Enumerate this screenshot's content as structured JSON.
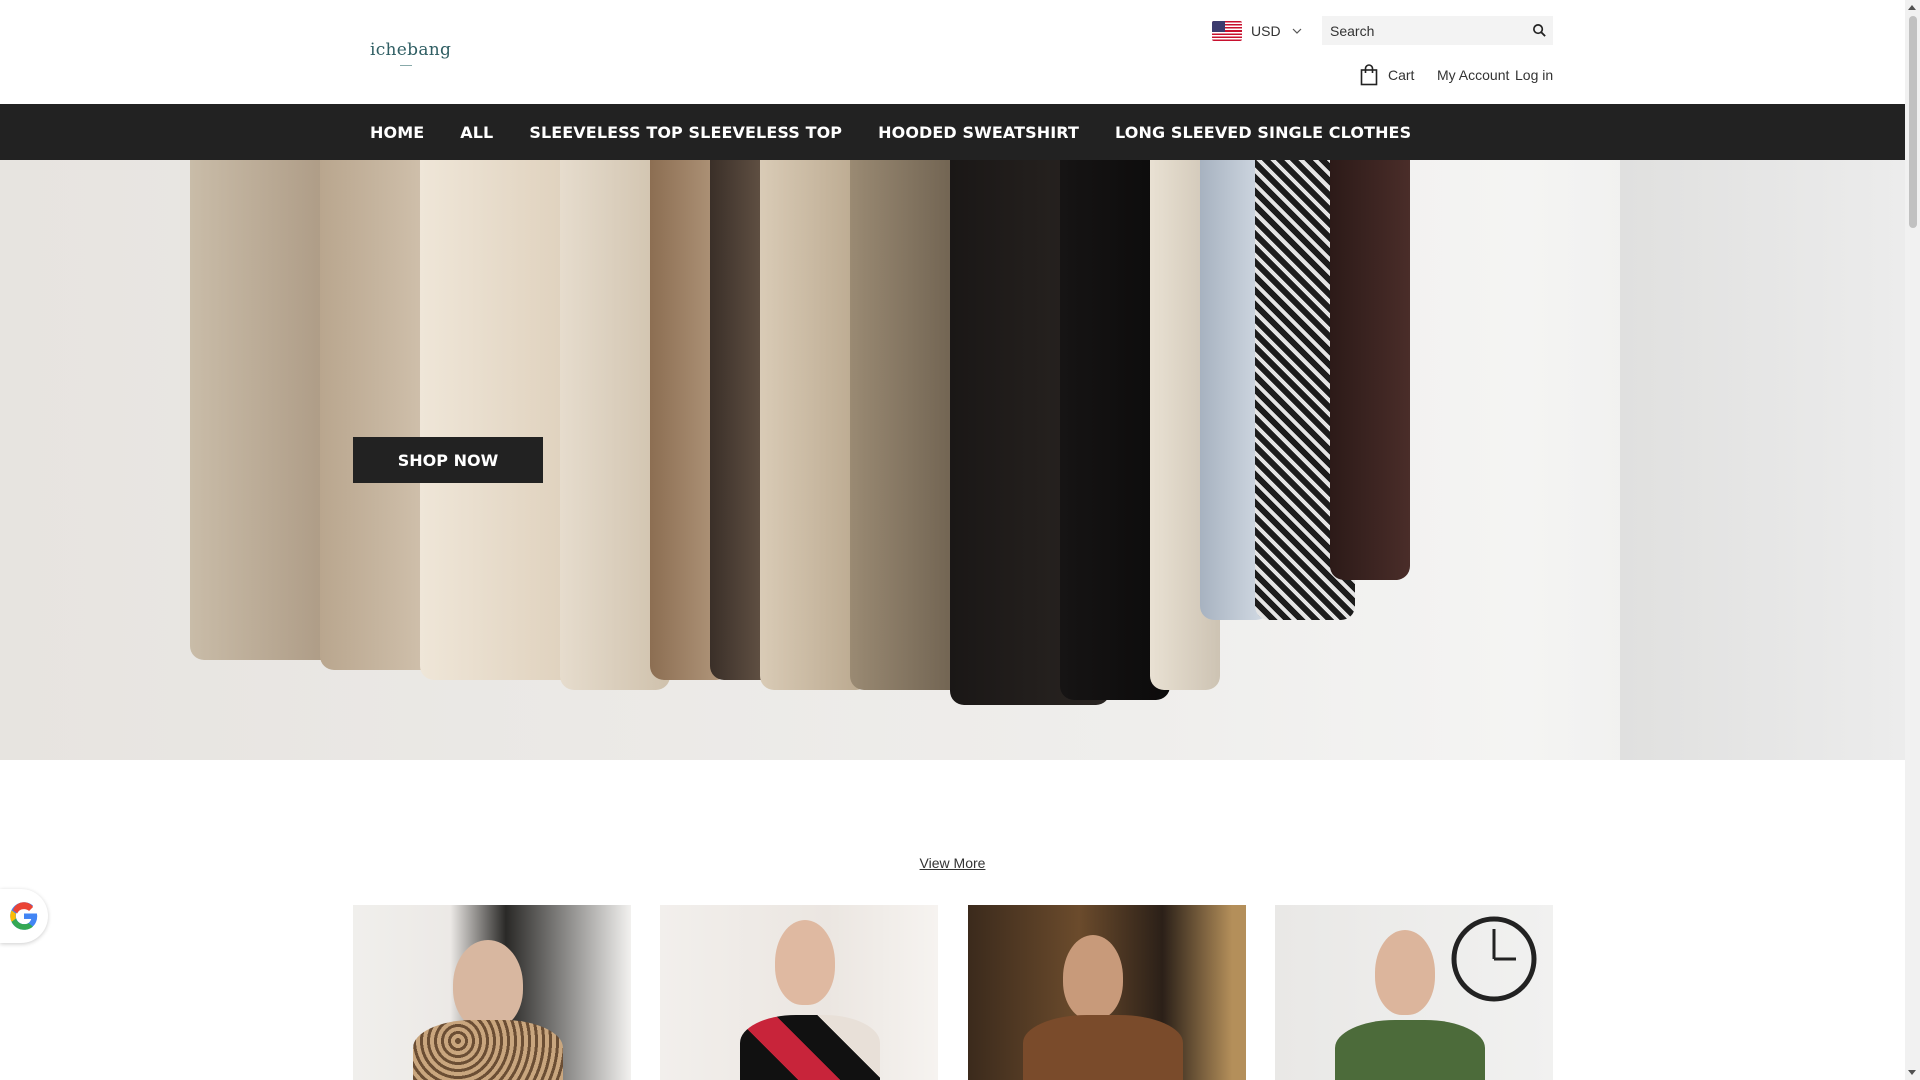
{
  "header": {
    "logo_text": "ichebang",
    "currency": {
      "code": "USD",
      "flag": "us-flag-icon"
    },
    "search": {
      "placeholder": "Search"
    },
    "cart_label": "Cart",
    "my_account_label": "My Account",
    "login_label": "Log in"
  },
  "nav": {
    "items": [
      {
        "label": "HOME"
      },
      {
        "label": "ALL"
      },
      {
        "label": "SLEEVELESS TOP SLEEVELESS TOP"
      },
      {
        "label": "HOODED SWEATSHIRT"
      },
      {
        "label": "LONG SLEEVED SINGLE CLOTHES"
      }
    ]
  },
  "hero": {
    "cta_label": "SHOP NOW"
  },
  "collection": {
    "view_more_label": "View More"
  },
  "colors": {
    "nav_background": "#222222",
    "logo": "#2f5e63",
    "button": "#222222"
  }
}
